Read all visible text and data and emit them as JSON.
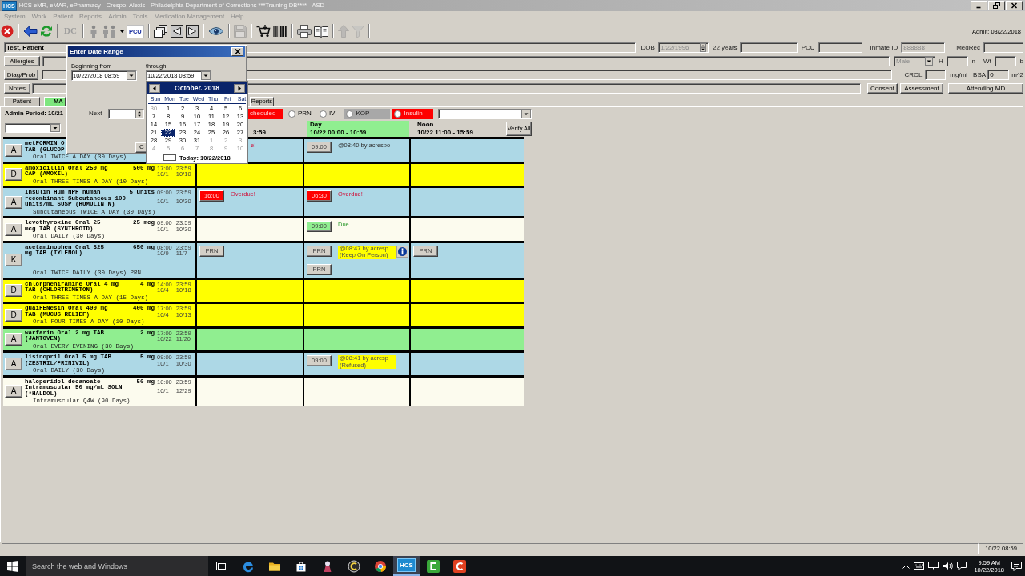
{
  "window": {
    "logo": "HCS",
    "title": "HCS eMR, eMAR, ePharmacy - Crespo, Alexis - Philadelphia Department of Corrections ***Training DB**** - ASD"
  },
  "menu": [
    {
      "label": "System",
      "disabled": true
    },
    {
      "label": "Work",
      "disabled": true
    },
    {
      "label": "Patient",
      "disabled": true
    },
    {
      "label": "Reports",
      "disabled": true
    },
    {
      "label": "Admin",
      "disabled": true
    },
    {
      "label": "Tools",
      "disabled": true
    },
    {
      "label": "Medication Management",
      "disabled": true
    },
    {
      "label": "Help",
      "disabled": true
    }
  ],
  "toolbar": {
    "admit": "Admit: 03/22/2018",
    "items": [
      {
        "kind": "icon",
        "disabled": false
      },
      {
        "kind": "icon",
        "disabled": false
      },
      {
        "kind": "icon",
        "disabled": false
      },
      {
        "kind": "text",
        "label": "DC",
        "disabled": true
      },
      {
        "kind": "icon",
        "disabled": false
      },
      {
        "kind": "icon",
        "disabled": false
      },
      {
        "kind": "text",
        "label": "PCU",
        "disabled": false
      },
      {
        "kind": "icon",
        "disabled": false
      },
      {
        "kind": "icon",
        "disabled": false
      },
      {
        "kind": "icon",
        "disabled": false
      },
      {
        "kind": "icon",
        "disabled": false
      },
      {
        "kind": "icon",
        "disabled": true
      },
      {
        "kind": "icon",
        "disabled": false
      },
      {
        "kind": "icon",
        "disabled": false
      },
      {
        "kind": "icon",
        "disabled": false
      },
      {
        "kind": "icon",
        "disabled": false
      },
      {
        "kind": "icon",
        "disabled": true
      },
      {
        "kind": "icon",
        "disabled": true
      }
    ]
  },
  "patient": {
    "name": "Test, Patient",
    "dob_label": "DOB",
    "dob": "1/22/1996",
    "age": "22 years",
    "pcu_label": "PCU",
    "inmate_id_label": "Inmate ID",
    "inmate_id": "888888",
    "medrec_label": "MedRec",
    "sex": "Male",
    "height_label": "H",
    "height_unit": "in",
    "weight_label": "Wt",
    "weight_unit": "lb",
    "crcl_label": "CRCL",
    "crcl_unit": "mg/mi",
    "bsa_label": "BSA",
    "bsa": "0",
    "bsa_unit": "m^2",
    "side_buttons": [
      "Allergies",
      "Diag/Prob",
      "Notes"
    ],
    "action_buttons": [
      "Consent",
      "Assessment",
      "Attending MD"
    ]
  },
  "tabs": [
    {
      "label": "Patient",
      "selected": false
    },
    {
      "label": "MA",
      "selected": true
    },
    {
      "label": "Reports",
      "selected": false
    }
  ],
  "mar": {
    "admin_period": "Admin Period: 10/21",
    "filters": [
      {
        "kind": "tag",
        "label": "cheduled",
        "color": "#ff0000"
      },
      {
        "kind": "radio",
        "label": "PRN",
        "checked": false
      },
      {
        "kind": "radio",
        "label": "IV",
        "checked": false
      },
      {
        "kind": "radio",
        "label": "KOP",
        "checked": false,
        "color": "#a8a8a8"
      },
      {
        "kind": "radio",
        "label": "Insulin",
        "checked": false,
        "color": "#ff0000"
      }
    ],
    "columns": [
      {
        "range": "3:59",
        "current": false
      },
      {
        "name": "Day",
        "range": "10/22 00:00 - 10:59",
        "current": true
      },
      {
        "name": "Noon",
        "range": "10/22 11:00 - 15:59",
        "current": false
      }
    ],
    "verify_button": "Verify All",
    "rows": [
      {
        "status": "A",
        "color": "#add8e6",
        "name_lines": [
          "metFORMIN O",
          "TAB (GLUCOP"
        ],
        "frequency": "Oral TWICE A DAY (30 Days)",
        "column_1": [
          [
            {
              "kind": "alert",
              "text": "e!"
            }
          ]
        ],
        "column_2": [
          [
            {
              "kind": "button",
              "label": "09:00",
              "color": "#d4d0c8"
            },
            {
              "kind": "note",
              "lines": [
                "@08:40 by acrespo"
              ],
              "highlight": false
            }
          ]
        ]
      },
      {
        "status": "D",
        "color": "#ffff00",
        "name_lines": [
          "amoxicillin Oral 250 mg",
          "CAP (AMOXIL)"
        ],
        "dose": "500 mg",
        "start_time": "17:00",
        "start_date": "10/1",
        "end_time": "23:59",
        "end_date": "10/10",
        "frequency": "Oral THREE TIMES A DAY (10 Days)"
      },
      {
        "status": "A",
        "color": "#add8e6",
        "name_lines": [
          "Insulin Hum NPH human",
          "recombinant Subcutaneous 100",
          "units/mL SUSP (HUMULIN N)"
        ],
        "dose": "5 units",
        "start_time": "09:00",
        "start_date": "10/1",
        "end_time": "23:59",
        "end_date": "10/30",
        "frequency": "Subcutaneous TWICE A DAY (30 Days)",
        "column_1": [
          [
            {
              "kind": "button",
              "label": "16:00",
              "color": "#ff0000"
            },
            {
              "kind": "alert",
              "text": "Overdue!"
            }
          ]
        ],
        "column_2": [
          [
            {
              "kind": "button",
              "label": "06:30",
              "color": "#ff0000"
            },
            {
              "kind": "alert",
              "text": "Overdue!"
            }
          ]
        ]
      },
      {
        "status": "A",
        "color": "#fcfbee",
        "name_lines": [
          "levothyroxine Oral 25",
          "mcg TAB (SYNTHROID)"
        ],
        "dose": "25 mcg",
        "start_time": "09:00",
        "start_date": "10/1",
        "end_time": "23:59",
        "end_date": "10/30",
        "frequency": "Oral DAILY (30 Days)",
        "column_2": [
          [
            {
              "kind": "button",
              "label": "09:00",
              "color": "#90ee90"
            },
            {
              "kind": "due",
              "text": "Due"
            }
          ]
        ]
      },
      {
        "status": "K",
        "color": "#add8e6",
        "name_lines": [
          "acetaminophen Oral 325",
          "mg TAB (TYLENOL)"
        ],
        "dose": "650 mg",
        "start_time": "08:00",
        "start_date": "10/9",
        "end_time": "23:59",
        "end_date": "11/7",
        "frequency": "Oral TWICE DAILY (30 Days) PRN",
        "column_1": [
          [
            {
              "kind": "button",
              "label": "PRN",
              "color": "#d4d0c8"
            }
          ]
        ],
        "column_2": [
          [
            {
              "kind": "button",
              "label": "PRN",
              "color": "#d4d0c8"
            },
            {
              "kind": "note",
              "lines": [
                "@08:47 by acresp",
                "(Keep On Person)"
              ],
              "highlight": true
            },
            {
              "kind": "info"
            }
          ],
          [
            {
              "kind": "button",
              "label": "PRN",
              "color": "#d4d0c8"
            }
          ]
        ],
        "column_3": [
          [
            {
              "kind": "button",
              "label": "PRN",
              "color": "#d4d0c8"
            }
          ]
        ]
      },
      {
        "status": "D",
        "color": "#ffff00",
        "name_lines": [
          "chlorpheniramine Oral 4 mg",
          "TAB (CHLORTRIMETON)"
        ],
        "dose": "4 mg",
        "start_time": "14:00",
        "start_date": "10/4",
        "end_time": "23:59",
        "end_date": "10/18",
        "frequency": "Oral THREE TIMES A DAY (15 Days)"
      },
      {
        "status": "D",
        "color": "#ffff00",
        "name_lines": [
          "guaiFENesin Oral 400 mg",
          "TAB (MUCUS RELIEF)"
        ],
        "dose": "400 mg",
        "start_time": "17:00",
        "start_date": "10/4",
        "end_time": "23:59",
        "end_date": "10/13",
        "frequency": "Oral FOUR TIMES A DAY (10 Days)"
      },
      {
        "status": "A",
        "color": "#90ee90",
        "name_lines": [
          "warfarin Oral 2 mg TAB",
          "(JANTOVEN)"
        ],
        "dose": "2 mg",
        "start_time": "17:00",
        "start_date": "10/22",
        "end_time": "23:59",
        "end_date": "11/20",
        "frequency": "Oral EVERY EVENING (30 Days)"
      },
      {
        "status": "A",
        "color": "#add8e6",
        "name_lines": [
          "lisinopril Oral 5 mg TAB",
          "(ZESTRIL/PRINIVIL)"
        ],
        "dose": "5 mg",
        "start_time": "09:00",
        "start_date": "10/1",
        "end_time": "23:59",
        "end_date": "10/30",
        "frequency": "Oral DAILY (30 Days)",
        "column_2": [
          [
            {
              "kind": "button",
              "label": "09:00",
              "color": "#d4d0c8"
            },
            {
              "kind": "note",
              "lines": [
                "@08:41 by acresp",
                "(Refused)"
              ],
              "highlight": true
            }
          ]
        ]
      },
      {
        "status": "A",
        "color": "#fcfbee",
        "name_lines": [
          "haloperidol decanoate",
          "Intramuscular 50 mg/mL SOLN",
          "(*HALDOL)"
        ],
        "dose": "50 mg",
        "start_time": "10:00",
        "start_date": "10/1",
        "end_time": "23:59",
        "end_date": "12/29",
        "frequency": "Intramuscular Q4W (90 Days)"
      }
    ]
  },
  "date_dialog": {
    "title": "Enter Date Range",
    "from_label": "Beginning from",
    "from_value": "10/22/2018 08:59",
    "through_label": "through",
    "through_value": "10/22/2018 08:59",
    "next_label": "Next",
    "button": "C",
    "calendar": {
      "month": "October. 2018",
      "weekdays": [
        "Sun",
        "Mon",
        "Tue",
        "Wed",
        "Thu",
        "Fri",
        "Sat"
      ],
      "weeks": [
        [
          {
            "day": "30",
            "other_month": true,
            "selected": false
          },
          {
            "day": "1",
            "other_month": false,
            "selected": false
          },
          {
            "day": "2",
            "other_month": false,
            "selected": false
          },
          {
            "day": "3",
            "other_month": false,
            "selected": false
          },
          {
            "day": "4",
            "other_month": false,
            "selected": false
          },
          {
            "day": "5",
            "other_month": false,
            "selected": false
          },
          {
            "day": "6",
            "other_month": false,
            "selected": false
          }
        ],
        [
          {
            "day": "7",
            "other_month": false,
            "selected": false
          },
          {
            "day": "8",
            "other_month": false,
            "selected": false
          },
          {
            "day": "9",
            "other_month": false,
            "selected": false
          },
          {
            "day": "10",
            "other_month": false,
            "selected": false
          },
          {
            "day": "11",
            "other_month": false,
            "selected": false
          },
          {
            "day": "12",
            "other_month": false,
            "selected": false
          },
          {
            "day": "13",
            "other_month": false,
            "selected": false
          }
        ],
        [
          {
            "day": "14",
            "other_month": false,
            "selected": false
          },
          {
            "day": "15",
            "other_month": false,
            "selected": false
          },
          {
            "day": "16",
            "other_month": false,
            "selected": false
          },
          {
            "day": "17",
            "other_month": false,
            "selected": false
          },
          {
            "day": "18",
            "other_month": false,
            "selected": false
          },
          {
            "day": "19",
            "other_month": false,
            "selected": false
          },
          {
            "day": "20",
            "other_month": false,
            "selected": false
          }
        ],
        [
          {
            "day": "21",
            "other_month": false,
            "selected": false
          },
          {
            "day": "22",
            "other_month": false,
            "selected": true
          },
          {
            "day": "23",
            "other_month": false,
            "selected": false
          },
          {
            "day": "24",
            "other_month": false,
            "selected": false
          },
          {
            "day": "25",
            "other_month": false,
            "selected": false
          },
          {
            "day": "26",
            "other_month": false,
            "selected": false
          },
          {
            "day": "27",
            "other_month": false,
            "selected": false
          }
        ],
        [
          {
            "day": "28",
            "other_month": false,
            "selected": false
          },
          {
            "day": "29",
            "other_month": false,
            "selected": false
          },
          {
            "day": "30",
            "other_month": false,
            "selected": false
          },
          {
            "day": "31",
            "other_month": false,
            "selected": false
          },
          {
            "day": "1",
            "other_month": true,
            "selected": false
          },
          {
            "day": "2",
            "other_month": true,
            "selected": false
          },
          {
            "day": "3",
            "other_month": true,
            "selected": false
          }
        ],
        [
          {
            "day": "4",
            "other_month": true,
            "selected": false
          },
          {
            "day": "5",
            "other_month": true,
            "selected": false
          },
          {
            "day": "6",
            "other_month": true,
            "selected": false
          },
          {
            "day": "7",
            "other_month": true,
            "selected": false
          },
          {
            "day": "8",
            "other_month": true,
            "selected": false
          },
          {
            "day": "9",
            "other_month": true,
            "selected": false
          },
          {
            "day": "10",
            "other_month": true,
            "selected": false
          }
        ]
      ],
      "today": "Today: 10/22/2018"
    }
  },
  "status_bar": {
    "datetime": "10/22 08:59"
  },
  "taskbar": {
    "search_placeholder": "Search the web and Windows",
    "apps": [
      {
        "selected": false
      },
      {
        "selected": false
      },
      {
        "selected": false
      },
      {
        "selected": false
      },
      {
        "selected": false
      },
      {
        "selected": false
      },
      {
        "selected": false
      },
      {
        "label": "HCS",
        "selected": true
      },
      {
        "selected": false
      },
      {
        "selected": false
      }
    ],
    "time": "9:59 AM",
    "date": "10/22/2018"
  }
}
